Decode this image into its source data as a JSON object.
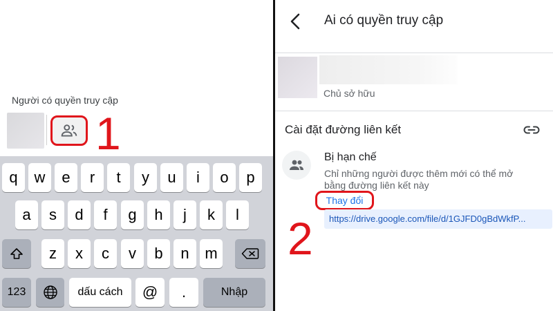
{
  "left": {
    "access_label": "Người có quyền truy cập",
    "step_number": "1"
  },
  "keyboard": {
    "row1": [
      "q",
      "w",
      "e",
      "r",
      "t",
      "y",
      "u",
      "i",
      "o",
      "p"
    ],
    "row2": [
      "a",
      "s",
      "d",
      "f",
      "g",
      "h",
      "j",
      "k",
      "l"
    ],
    "row3": [
      "z",
      "x",
      "c",
      "v",
      "b",
      "n",
      "m"
    ],
    "numbers_key": "123",
    "space_key": "dấu cách",
    "at_key": "@",
    "dot_key": ".",
    "return_key": "Nhập"
  },
  "right": {
    "title": "Ai có quyền truy cập",
    "owner_role": "Chủ sở hữu",
    "link_settings": "Cài đặt đường liên kết",
    "restricted_title": "Bị hạn chế",
    "restricted_desc": "Chỉ những người được thêm mới có thể mở bằng đường liên kết này",
    "change_button": "Thay đổi",
    "url": "https://drive.google.com/file/d/1GJFD0gBdWkfP...",
    "step_number": "2"
  },
  "colors": {
    "highlight_red": "#e0151b",
    "link_blue": "#1a73e8",
    "keyboard_bg": "#d1d3d9"
  }
}
